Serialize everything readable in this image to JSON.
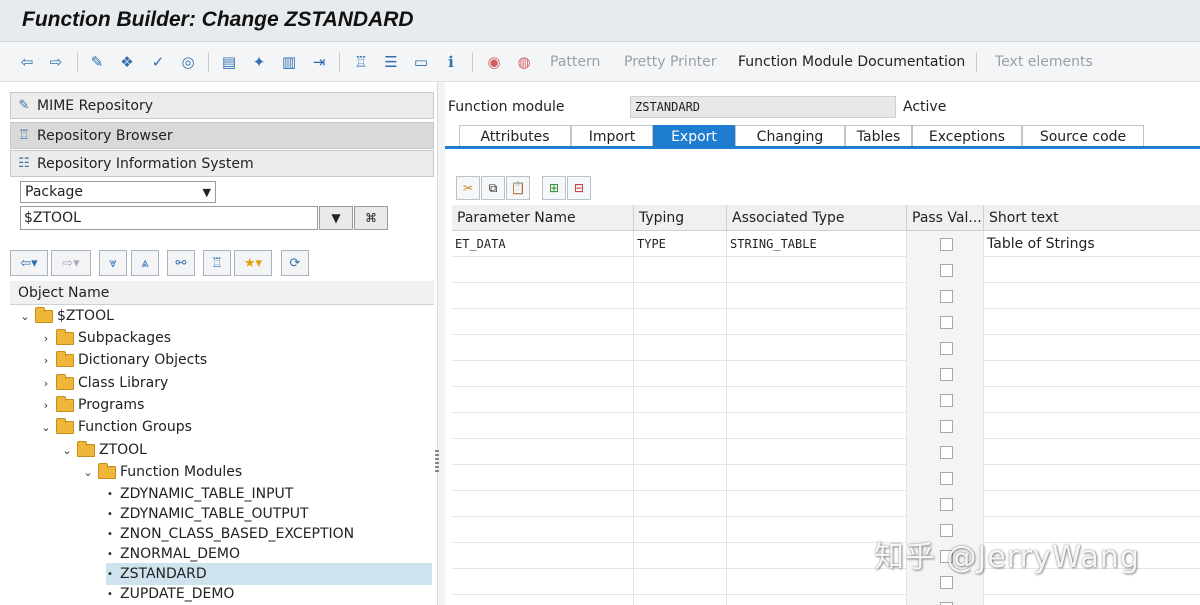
{
  "window": {
    "title": "Function Builder: Change ZSTANDARD"
  },
  "toolbar": {
    "pattern": "Pattern",
    "pretty_printer": "Pretty Printer",
    "fm_documentation": "Function Module Documentation",
    "text_elements": "Text elements"
  },
  "nav": {
    "items": [
      {
        "label": "MIME Repository",
        "icon": "mime-icon"
      },
      {
        "label": "Repository Browser",
        "icon": "hierarchy-icon"
      },
      {
        "label": "Repository Information System",
        "icon": "info-system-icon"
      }
    ],
    "object_type": "Package",
    "object_value": "$ZTOOL"
  },
  "tree": {
    "header": "Object Name",
    "nodes": [
      {
        "label": "$ZTOOL"
      },
      {
        "label": "Subpackages"
      },
      {
        "label": "Dictionary Objects"
      },
      {
        "label": "Class Library"
      },
      {
        "label": "Programs"
      },
      {
        "label": "Function Groups"
      },
      {
        "label": "ZTOOL"
      },
      {
        "label": "Function Modules"
      },
      {
        "label": "ZDYNAMIC_TABLE_INPUT"
      },
      {
        "label": "ZDYNAMIC_TABLE_OUTPUT"
      },
      {
        "label": "ZNON_CLASS_BASED_EXCEPTION"
      },
      {
        "label": "ZNORMAL_DEMO"
      },
      {
        "label": "ZSTANDARD"
      },
      {
        "label": "ZUPDATE_DEMO"
      }
    ]
  },
  "fm": {
    "label": "Function module",
    "value": "ZSTANDARD",
    "status": "Active"
  },
  "tabs": [
    "Attributes",
    "Import",
    "Export",
    "Changing",
    "Tables",
    "Exceptions",
    "Source code"
  ],
  "active_tab": "Export",
  "grid": {
    "headers": [
      "Parameter Name",
      "Typing",
      "Associated Type",
      "Pass Val...",
      "Short text"
    ],
    "rows": [
      {
        "param": "ET_DATA",
        "typing": "TYPE",
        "assoc": "STRING_TABLE",
        "pass_value": false,
        "short_text": "Table of Strings"
      }
    ]
  },
  "watermark": "知乎 @JerryWang",
  "colors": {
    "accent": "#1f7dcf",
    "folder": "#f0b63a",
    "selected_row": "#cfe3ef"
  }
}
